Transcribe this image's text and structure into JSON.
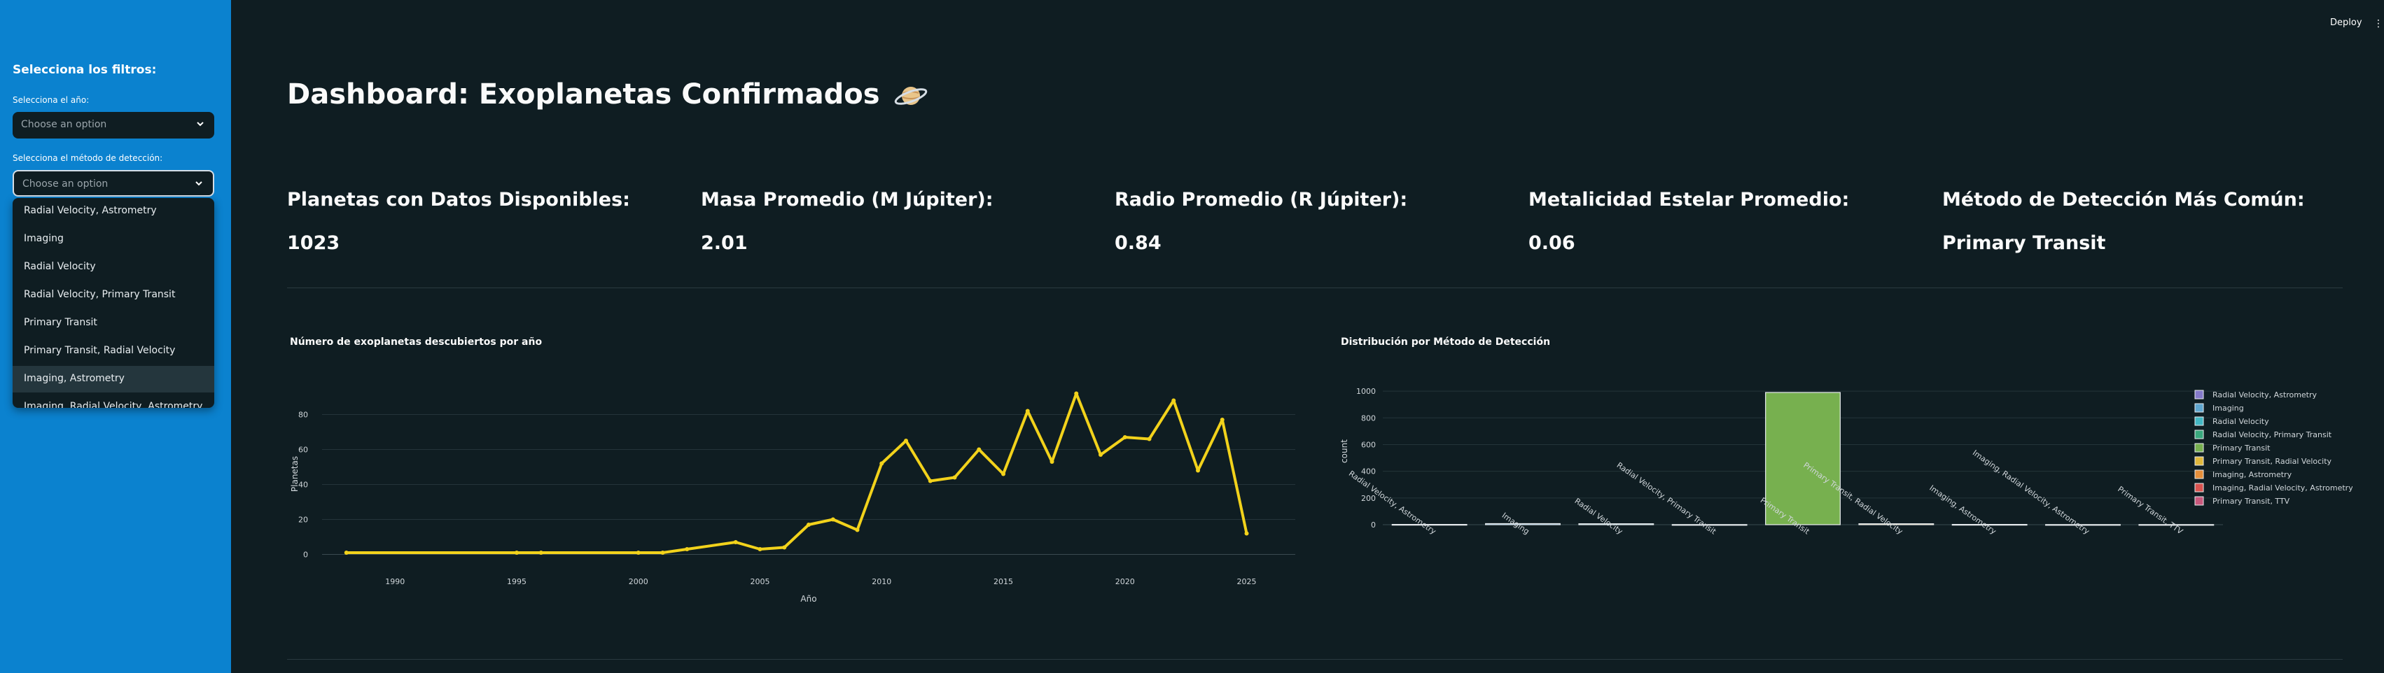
{
  "header": {
    "deploy_label": "Deploy",
    "menu_glyph": "⋮"
  },
  "sidebar": {
    "heading": "Selecciona los filtros:",
    "year_label": "Selecciona el año:",
    "year_placeholder": "Choose an option",
    "method_label": "Selecciona el método de detección:",
    "method_placeholder": "Choose an option",
    "options": [
      "Radial Velocity, Astrometry",
      "Imaging",
      "Radial Velocity",
      "Radial Velocity, Primary Transit",
      "Primary Transit",
      "Primary Transit, Radial Velocity",
      "Imaging, Astrometry",
      "Imaging, Radial Velocity, Astrometry"
    ],
    "highlighted_option": "Imaging, Astrometry"
  },
  "main": {
    "title": "Dashboard: Exoplanetas Confirmados",
    "title_icon": "ringed-planet-icon",
    "metrics": [
      {
        "label": "Planetas con Datos Disponibles:",
        "value": "1023"
      },
      {
        "label": "Masa Promedio (M Júpiter):",
        "value": "2.01"
      },
      {
        "label": "Radio Promedio (R Júpiter):",
        "value": "0.84"
      },
      {
        "label": "Metalicidad Estelar Promedio:",
        "value": "0.06"
      },
      {
        "label": "Método de Detección Más Común:",
        "value": "Primary Transit"
      }
    ]
  },
  "colors": {
    "sidebar_bg": "#0b82cf",
    "page_bg": "#0f1d22",
    "line": "#f2d21b",
    "bar_green": "#77b04f"
  },
  "chart_data": [
    {
      "type": "line",
      "title": "Número de exoplanetas descubiertos por año",
      "xlabel": "Año",
      "ylabel": "Planetas",
      "xlim": [
        1987,
        2027
      ],
      "ylim": [
        -5,
        97
      ],
      "x_ticks": [
        1990,
        1995,
        2000,
        2005,
        2010,
        2015,
        2020,
        2025
      ],
      "y_ticks": [
        0,
        20,
        40,
        60,
        80
      ],
      "series": [
        {
          "x": [
            1988,
            1995,
            1996,
            2000,
            2001,
            2002,
            2004,
            2005,
            2006,
            2007,
            2008,
            2009,
            2010,
            2011,
            2012,
            2013,
            2014,
            2015,
            2016,
            2017,
            2018,
            2019,
            2020,
            2021,
            2022,
            2023,
            2024,
            2025
          ],
          "y": [
            1,
            1,
            1,
            1,
            1,
            3,
            7,
            3,
            4,
            17,
            20,
            14,
            52,
            65,
            42,
            44,
            60,
            46,
            82,
            53,
            92,
            57,
            67,
            66,
            88,
            48,
            77,
            12
          ]
        }
      ],
      "grid": true
    },
    {
      "type": "bar",
      "title": "Distribución por Método de Detección",
      "xlabel": "",
      "ylabel": "count",
      "ylim": [
        0,
        1100
      ],
      "y_ticks": [
        0,
        200,
        400,
        600,
        800,
        1000
      ],
      "categories": [
        "Radial Velocity, Astrometry",
        "Imaging",
        "Radial Velocity",
        "Radial Velocity, Primary Transit",
        "Primary Transit",
        "Primary Transit, Radial Velocity",
        "Imaging, Astrometry",
        "Imaging, Radial Velocity, Astrometry",
        "Primary Transit, TTV"
      ],
      "values": [
        2,
        8,
        7,
        1,
        990,
        7,
        2,
        1,
        1
      ],
      "legend": [
        {
          "name": "Radial Velocity, Astrometry",
          "color": "#8479c9"
        },
        {
          "name": "Imaging",
          "color": "#5fa6cf"
        },
        {
          "name": "Radial Velocity",
          "color": "#43b7c3"
        },
        {
          "name": "Radial Velocity, Primary Transit",
          "color": "#3aa87d"
        },
        {
          "name": "Primary Transit",
          "color": "#77b04f"
        },
        {
          "name": "Primary Transit, Radial Velocity",
          "color": "#e0b73b"
        },
        {
          "name": "Imaging, Astrometry",
          "color": "#e68f3a"
        },
        {
          "name": "Imaging, Radial Velocity, Astrometry",
          "color": "#d9534f"
        },
        {
          "name": "Primary Transit, TTV",
          "color": "#c9587c"
        }
      ],
      "legend_position": "right",
      "grid": true
    }
  ]
}
